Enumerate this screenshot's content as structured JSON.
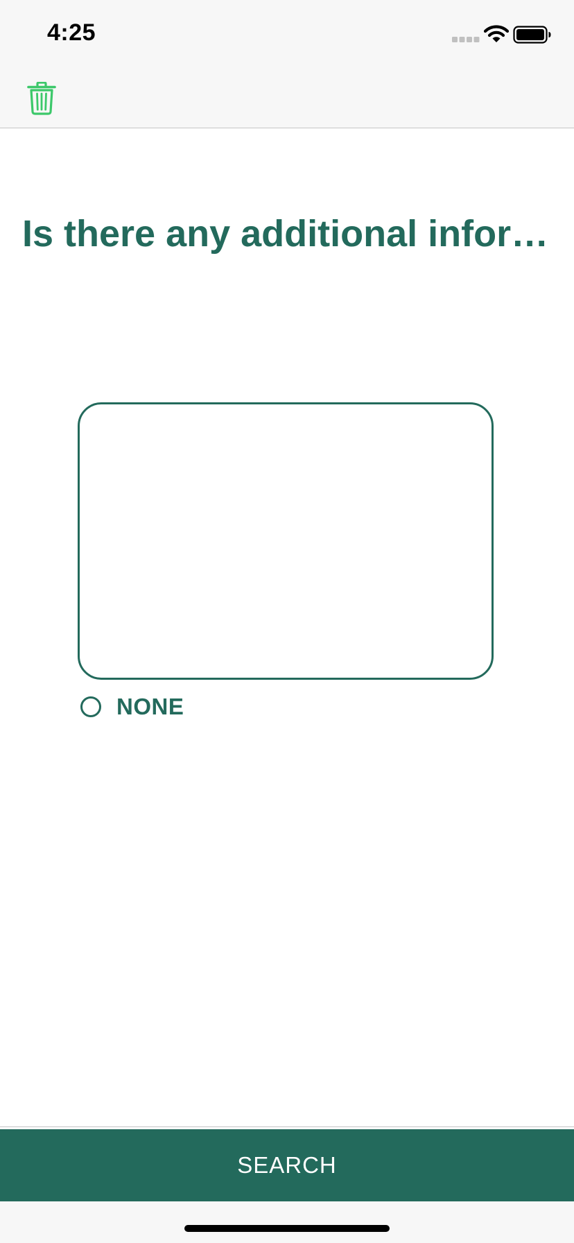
{
  "status_bar": {
    "time": "4:25",
    "icons": [
      "signal-icon",
      "wifi-icon",
      "battery-icon"
    ]
  },
  "nav_bar": {
    "icons": [
      "trash-icon"
    ]
  },
  "question": {
    "title": "Is there any additional information"
  },
  "answer": {
    "value": "",
    "placeholder": ""
  },
  "none_option": {
    "label": "NONE",
    "selected": false
  },
  "search_button": {
    "label": "SEARCH"
  },
  "colors": {
    "primary": "#236a5c",
    "trash_icon": "#3cc86a",
    "bar_background": "#f7f7f7"
  }
}
